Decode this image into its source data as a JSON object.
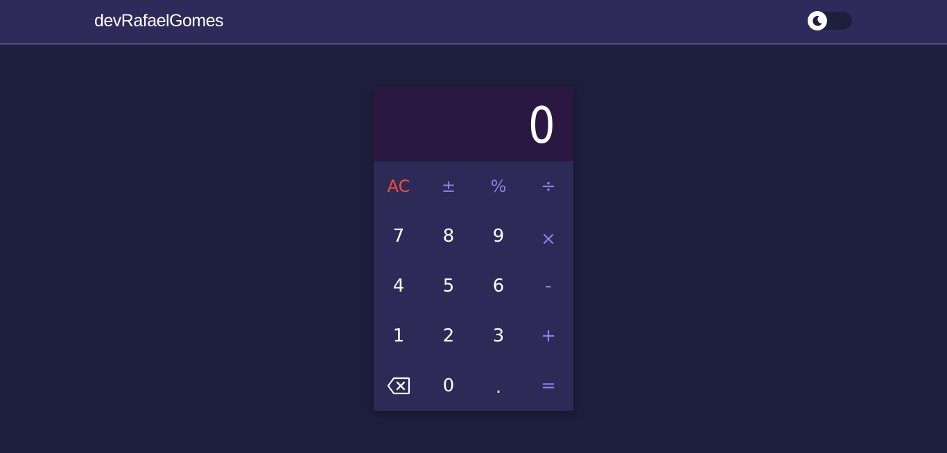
{
  "header": {
    "brand": "devRafaelGomes",
    "theme_toggle_icon": "moon-icon"
  },
  "calculator": {
    "display": "0",
    "keys": {
      "clear": "AC",
      "sign": "±",
      "percent": "%",
      "divide": "÷",
      "seven": "7",
      "eight": "8",
      "nine": "9",
      "multiply": "×",
      "four": "4",
      "five": "5",
      "six": "6",
      "minus": "-",
      "one": "1",
      "two": "2",
      "three": "3",
      "plus": "+",
      "backspace_icon": "backspace-icon",
      "zero": "0",
      "decimal": ".",
      "equals": "="
    }
  },
  "colors": {
    "page_bg": "#1e1f3d",
    "topbar_bg": "#2e2a5a",
    "display_bg": "#2a1843",
    "keypad_bg": "#2d2a58",
    "operator": "#8f80e6",
    "clear": "#ef5138"
  }
}
